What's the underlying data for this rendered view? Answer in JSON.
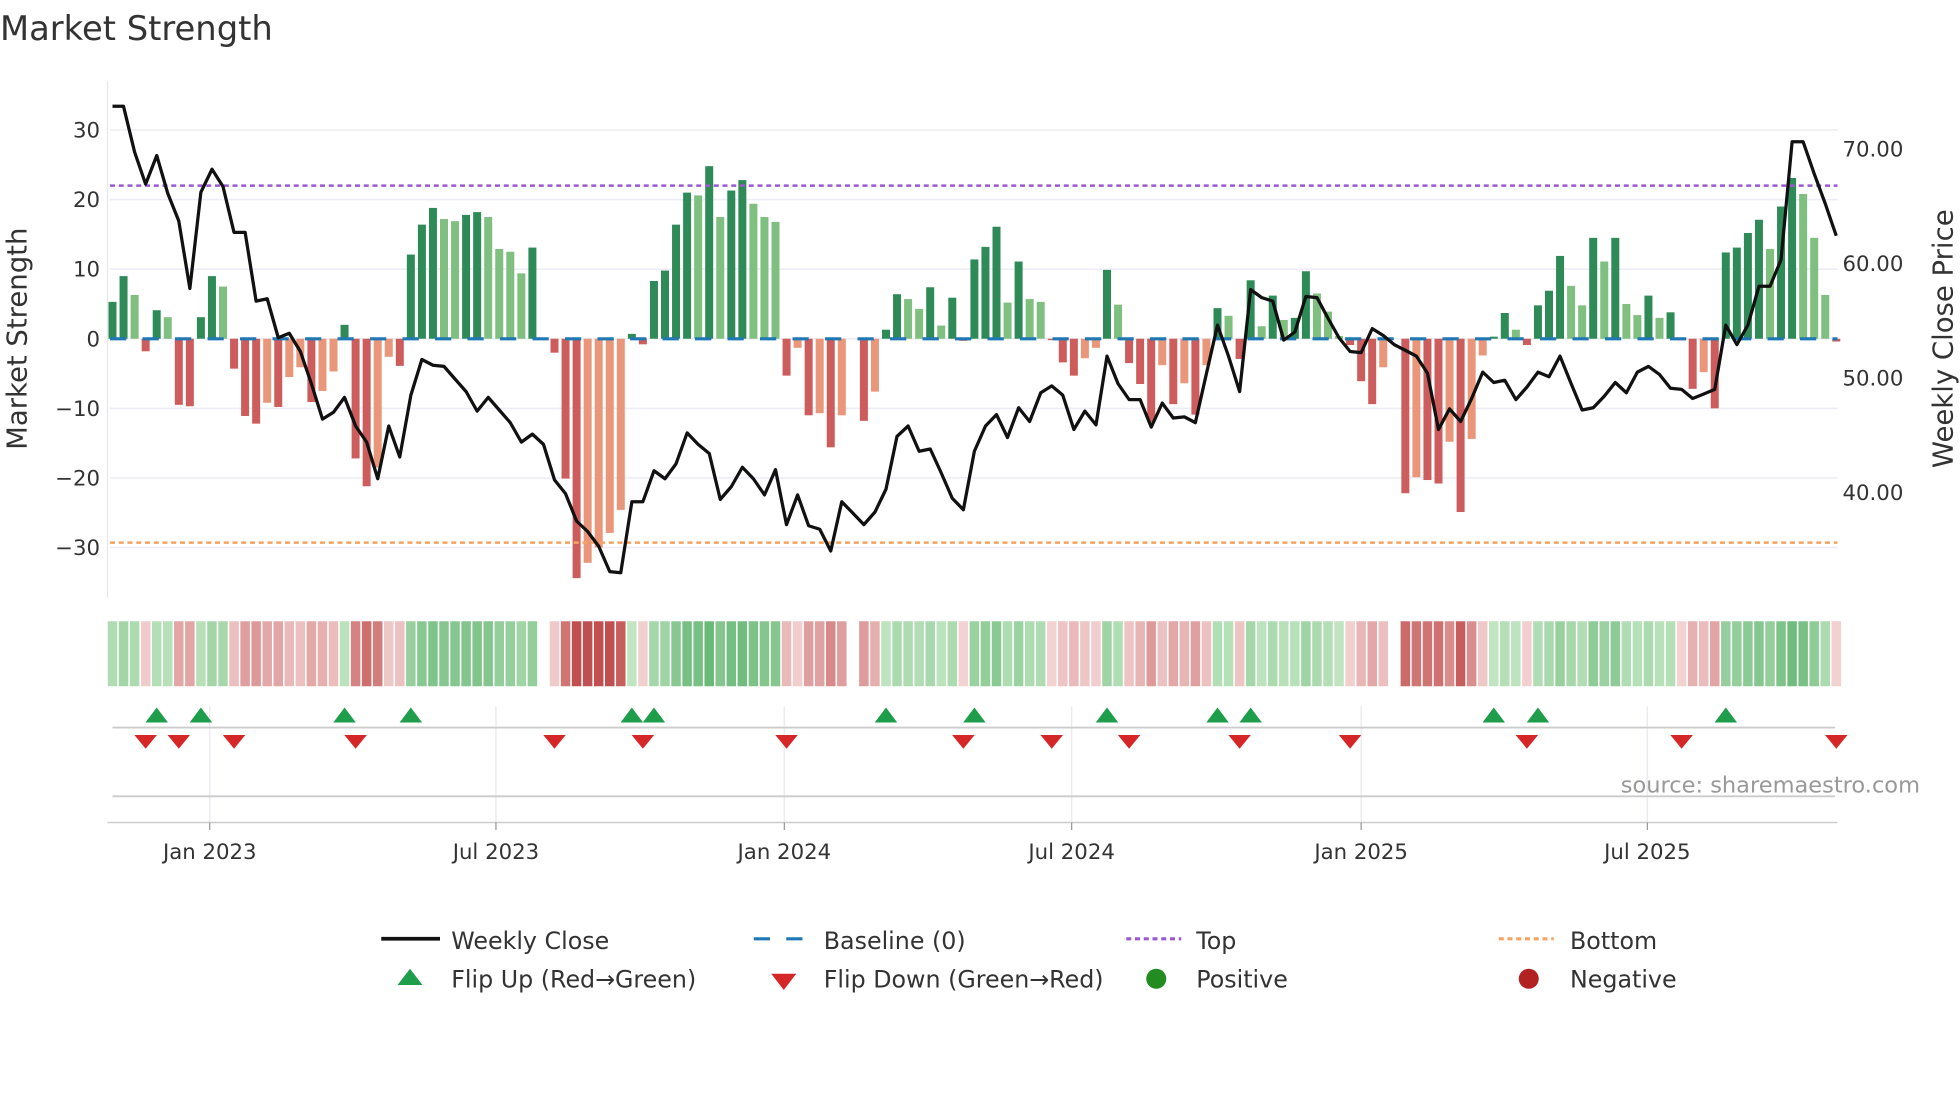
{
  "chart_data": {
    "type": "bar",
    "title": "Market Strength",
    "ylabel": "Market Strength",
    "y2label": "Weekly Close Price",
    "ylim": [
      -35,
      35
    ],
    "y2lim": [
      32,
      76
    ],
    "yticks": [
      "30",
      "20",
      "10",
      "0",
      "−10",
      "−20",
      "−30"
    ],
    "ytick_values": [
      30,
      20,
      10,
      0,
      -10,
      -20,
      -30
    ],
    "y2ticks": [
      "70.00",
      "60.00",
      "50.00",
      "40.00"
    ],
    "y2tick_values": [
      70,
      60,
      50,
      40
    ],
    "xticks": [
      {
        "label": "Jan 2023",
        "week": 8.8
      },
      {
        "label": "Jul 2023",
        "week": 34.7
      },
      {
        "label": "Jan 2024",
        "week": 60.8
      },
      {
        "label": "Jul 2024",
        "week": 86.8
      },
      {
        "label": "Jan 2025",
        "week": 113
      },
      {
        "label": "Jul 2025",
        "week": 138.9
      }
    ],
    "top_level": 22,
    "bottom_level": -29.3,
    "strength": [
      5.3,
      9,
      6.3,
      -1.8,
      4.1,
      3.1,
      -9.5,
      -9.7,
      3.1,
      9,
      7.5,
      -4.3,
      -11.1,
      -12.2,
      -9.2,
      -9.8,
      -5.5,
      -4.1,
      -9.1,
      -7.5,
      -4.7,
      2,
      -17.2,
      -21.2,
      -18.5,
      -2.6,
      -3.9,
      12.1,
      16.4,
      18.8,
      17.2,
      16.9,
      17.8,
      18.2,
      17.5,
      12.9,
      12.5,
      9.4,
      13.1,
      0,
      -2,
      -20.1,
      -34.4,
      -32.2,
      -30,
      -27.9,
      -24.6,
      0.7,
      -0.8,
      8.3,
      9.8,
      16.4,
      21,
      20.6,
      24.8,
      17.5,
      21.3,
      22.8,
      19.4,
      17.5,
      16.8,
      -5.3,
      -1.3,
      -11,
      -10.7,
      -15.6,
      -11,
      0,
      -11.8,
      -7.6,
      1.3,
      6.4,
      5.7,
      4.3,
      7.4,
      1.9,
      5.9,
      -0.3,
      11.4,
      13.2,
      16.1,
      5.2,
      11.1,
      5.7,
      5.3,
      -0.2,
      -3.4,
      -5.3,
      -2.8,
      -1.3,
      9.9,
      4.9,
      -3.5,
      -6.5,
      -12,
      -3.8,
      -9.4,
      -6.4,
      -10.9,
      -3.8,
      4.4,
      3.3,
      -2.9,
      8.4,
      1.8,
      6.2,
      2.7,
      3,
      9.7,
      6.5,
      3.9,
      0.4,
      -0.9,
      -6.1,
      -9.4,
      -4.1,
      0,
      -22.2,
      -19.9,
      -20.3,
      -20.8,
      -14.8,
      -24.9,
      -14.4,
      -2.4,
      0.3,
      3.7,
      1.3,
      -0.9,
      4.8,
      6.9,
      11.9,
      7.6,
      4.8,
      14.5,
      11.1,
      14.5,
      5,
      3.4,
      6.2,
      3,
      3.8,
      -0.2,
      -7.2,
      -4.8,
      -10,
      12.4,
      13.1,
      15.2,
      17.1,
      12.9,
      19,
      23.1,
      20.8,
      14.5,
      6.3,
      -0.4
    ],
    "weekly_close": [
      73.6,
      73.6,
      69.6,
      66.8,
      69.3,
      66,
      63.6,
      57.7,
      66.1,
      68.1,
      66.6,
      62.6,
      62.6,
      56.6,
      56.8,
      53.4,
      53.8,
      52.2,
      49.4,
      46.3,
      46.9,
      48.2,
      45.7,
      44.3,
      41.1,
      45.7,
      43,
      48.4,
      51.5,
      51,
      50.9,
      49.8,
      48.7,
      47,
      48.2,
      47.1,
      46,
      44.3,
      45,
      44.1,
      41,
      39.8,
      37.4,
      36.5,
      35.2,
      33,
      32.9,
      39.1,
      39.1,
      41.8,
      41.1,
      42.4,
      45.1,
      44.1,
      43.3,
      39.3,
      40.4,
      42.1,
      41.1,
      39.7,
      41.9,
      37.1,
      39.7,
      37,
      36.7,
      34.8,
      39.1,
      38.1,
      37.1,
      38.2,
      40.2,
      44.8,
      45.7,
      43.5,
      43.7,
      41.6,
      39.4,
      38.4,
      43.5,
      45.7,
      46.7,
      44.7,
      47.3,
      46.1,
      48.6,
      49.2,
      48.4,
      45.4,
      47,
      45.8,
      51.8,
      49.4,
      48,
      48,
      45.6,
      47.7,
      46.4,
      46.5,
      46,
      50.3,
      54.5,
      51.8,
      48.7,
      57.6,
      56.9,
      56.6,
      53.2,
      53.9,
      57,
      56.9,
      55.1,
      53.4,
      52.2,
      52.1,
      54.2,
      53.6,
      52.8,
      52.3,
      51.8,
      50.3,
      45.4,
      47.2,
      46.1,
      48.1,
      50.4,
      49.5,
      49.7,
      48,
      49.1,
      50.4,
      50,
      51.8,
      49.4,
      47.1,
      47.3,
      48.3,
      49.5,
      48.6,
      50.4,
      50.9,
      50.2,
      49,
      48.9,
      48.1,
      48.5,
      48.9,
      54.5,
      52.8,
      54.5,
      57.9,
      57.9,
      60.2,
      70.5,
      70.5,
      67.7,
      65.1,
      62.3
    ],
    "flip_up_weeks": [
      4,
      8,
      21,
      27,
      47,
      49,
      70,
      78,
      90,
      100,
      103,
      125,
      129,
      146
    ],
    "flip_down_weeks": [
      3,
      6,
      11,
      22,
      40,
      48,
      61,
      77,
      85,
      92,
      102,
      112,
      128,
      142,
      156
    ],
    "colors": {
      "strong_positive": "#2e8b57",
      "weak_positive": "#7fbf7f",
      "strong_negative": "#cd5c5c",
      "weak_negative": "#e9967a",
      "close": "#111111",
      "baseline": "#1f77b4",
      "top": "#9b59d0",
      "bottom": "#f4a460",
      "flip_up": "#1e9e4a",
      "flip_down": "#d62728",
      "positive": "#228b22",
      "negative": "#b22222"
    },
    "legend": {
      "close": "Weekly Close",
      "baseline": "Baseline (0)",
      "top": "Top",
      "bottom": "Bottom",
      "flip_up": "Flip Up (Red→Green)",
      "flip_down": "Flip Down (Green→Red)",
      "positive": "Positive",
      "negative": "Negative"
    },
    "legend_placement": "bottom",
    "source": "source: sharemaestro.com"
  }
}
